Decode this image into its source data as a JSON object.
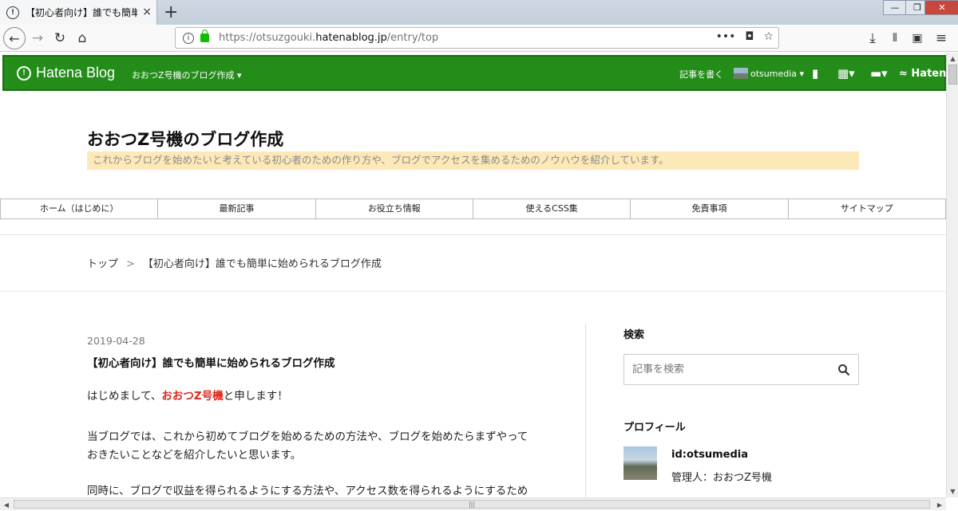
{
  "browser": {
    "tab_title": "【初心者向け】誰でも簡単に始",
    "tab_close": "×",
    "new_tab": "+",
    "url_prefix": "https://otsuzgouki.",
    "url_host": "hatenablog.jp",
    "url_path": "/entry/top",
    "minimize": "—",
    "restore": "❐",
    "close": "✕",
    "url_more": "•••"
  },
  "hatena_bar": {
    "logo": "Hatena Blog",
    "blog_menu": "おおつZ号機のブログ作成",
    "write": "記事を書く",
    "user": "otsumedia",
    "brand_right": "Hatena"
  },
  "blog": {
    "title": "おおつZ号機のブログ作成",
    "description": "これからブログを始めたいと考えている初心者のための作り方や、ブログでアクセスを集めるためのノウハウを紹介しています。"
  },
  "global_nav": [
    "ホーム（はじめに）",
    "最新記事",
    "お役立ち情報",
    "使えるCSS集",
    "免責事項",
    "サイトマップ"
  ],
  "breadcrumb": {
    "top": "トップ",
    "separator": ">",
    "current": "【初心者向け】誰でも簡単に始められるブログ作成"
  },
  "entry": {
    "date": "2019-04-28",
    "title": "【初心者向け】誰でも簡単に始められるブログ作成",
    "p1_before": "はじめまして、",
    "p1_highlight": "おおつZ号機",
    "p1_after": "と申します！",
    "p2_line1": "当ブログでは、これから初めてブログを始めるための方法や、ブログを始めたらまずやって",
    "p2_line2": "おきたいことなどを紹介したいと思います。",
    "p3_line1": "同時に、ブログで収益を得られるようにする方法や、アクセス数を得られるようにするため"
  },
  "sidebar": {
    "search_heading": "検索",
    "search_placeholder": "記事を検索",
    "profile_heading": "プロフィール",
    "profile_id": "id:otsumedia",
    "profile_role": "管理人：おおつZ号機"
  },
  "colors": {
    "hatena_green": "#248d1a",
    "desc_bg": "#fde9b8",
    "highlight_red": "#e0241a"
  }
}
